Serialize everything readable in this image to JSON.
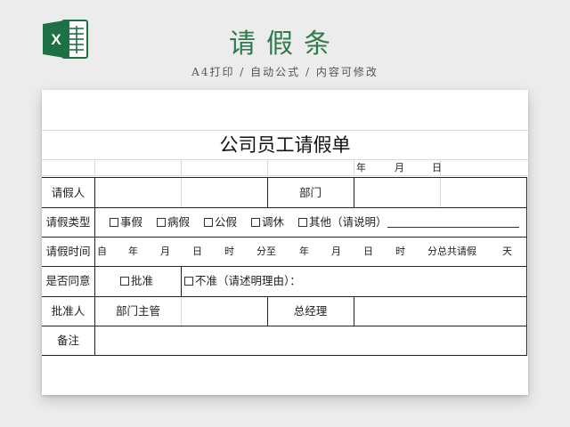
{
  "header": {
    "title": "请假条",
    "subtitle": "A4打印 / 自动公式 / 内容可修改",
    "logo_letter": "X"
  },
  "form": {
    "title": "公司员工请假单",
    "date_labels": {
      "year": "年",
      "month": "月",
      "day": "日"
    },
    "rows": {
      "applicant": {
        "label": "请假人",
        "dept_label": "部门"
      },
      "leave_type": {
        "label": "请假类型",
        "options": [
          "事假",
          "病假",
          "公假",
          "调休"
        ],
        "other": "其他（请说明）"
      },
      "leave_time": {
        "label": "请假时间",
        "from": "自",
        "units": [
          "年",
          "月",
          "日",
          "时"
        ],
        "minute_to": "分至",
        "minute_total": "分总共请假",
        "day_unit": "天"
      },
      "approval": {
        "label": "是否同意",
        "approve": "批准",
        "reject": "不准（请述明理由）："
      },
      "approver": {
        "label": "批准人",
        "dept_head": "部门主管",
        "gm": "总经理"
      },
      "remarks": {
        "label": "备注"
      }
    }
  },
  "colors": {
    "brand_green": "#2f7a4e",
    "logo_green": "#1e7145"
  }
}
